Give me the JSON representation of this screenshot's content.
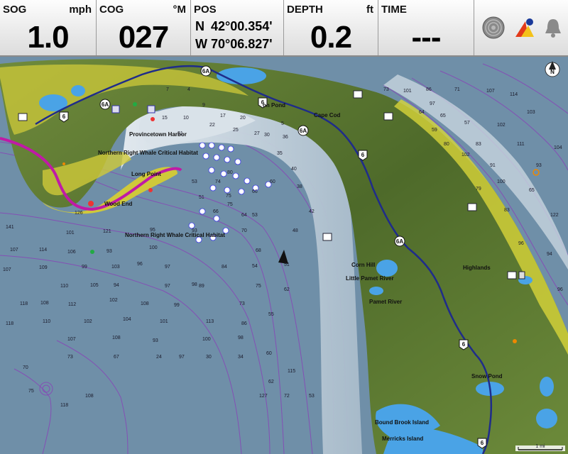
{
  "databar": {
    "sog": {
      "label": "SOG",
      "value": "1.0",
      "unit": "mph"
    },
    "cog": {
      "label": "COG",
      "value": "027",
      "unit": "°M"
    },
    "pos": {
      "label": "POS",
      "lat_hem": "N",
      "lat": "42°00.354'",
      "lon_hem": "W",
      "lon": "70°06.827'"
    },
    "depth": {
      "label": "DEPTH",
      "value": "0.2",
      "unit": "ft"
    },
    "time": {
      "label": "TIME",
      "value": "---"
    }
  },
  "icons": {
    "sonar": "sonar-disc-icon",
    "alarm": "alarm-warning-icon",
    "bell": "bell-icon",
    "north": "north-up-icon"
  },
  "colors": {
    "water": "#6f8fa8",
    "shallow": "#dfe6ec",
    "land": "#5e7a34",
    "coast": "#d8d43a",
    "lake": "#4aa3e6",
    "road": "#1f2c8a",
    "boundary": "#c01aa6",
    "contour": "#8a40b8"
  },
  "map": {
    "north_label": "N",
    "scale": "1 mi",
    "places": {
      "provincetown_harbor": "Provincetown Harbor",
      "nrwch_1": "Northern Right Whale Critical Habitat",
      "nrwch_2": "Northern Right Whale Critical Habitat",
      "long_point": "Long Point",
      "wood_end": "Wood End",
      "cape_cod": "Cape Cod",
      "pond": "on Pond",
      "corn_hill": "Corn Hill",
      "little_pamet": "Little Pamet River",
      "pamet_river": "Pamet River",
      "highlands": "Highlands",
      "snow_pond": "Snow Pond",
      "bound_brook": "Bound Brook Island",
      "merricks": "Merricks Island"
    },
    "routes": [
      "6A",
      "6",
      "6",
      "6A",
      "6",
      "6",
      "6"
    ],
    "soundings": [
      "141",
      "126",
      "101",
      "121",
      "95",
      "93",
      "114",
      "106",
      "93",
      "100",
      "107",
      "99",
      "103",
      "96",
      "97",
      "109",
      "107",
      "105",
      "110",
      "118",
      "108",
      "110",
      "94",
      "112",
      "102",
      "97",
      "98",
      "108",
      "104",
      "99",
      "118",
      "102",
      "101",
      "113",
      "84",
      "107",
      "108",
      "93",
      "100",
      "98",
      "97",
      "73",
      "89",
      "86",
      "75",
      "70",
      "54",
      "64",
      "75",
      "68",
      "55",
      "60",
      "62",
      "53",
      "51",
      "48",
      "40",
      "35",
      "38",
      "42",
      "30",
      "22",
      "25",
      "27",
      "21",
      "20",
      "17",
      "10",
      "15",
      "9",
      "5",
      "7",
      "4",
      "60",
      "80",
      "53",
      "74",
      "36",
      "66",
      "75",
      "51",
      "66",
      "73",
      "101",
      "86",
      "97",
      "71",
      "64",
      "65",
      "59",
      "57",
      "80",
      "83",
      "102",
      "107",
      "114",
      "103",
      "102",
      "111",
      "91",
      "100",
      "79",
      "83",
      "65",
      "93",
      "104",
      "122",
      "96",
      "94",
      "96",
      "70",
      "75",
      "118",
      "108",
      "127",
      "115",
      "62",
      "72",
      "53",
      "34",
      "30",
      "24",
      "67",
      "73",
      "88",
      "100",
      "105",
      "109"
    ]
  }
}
